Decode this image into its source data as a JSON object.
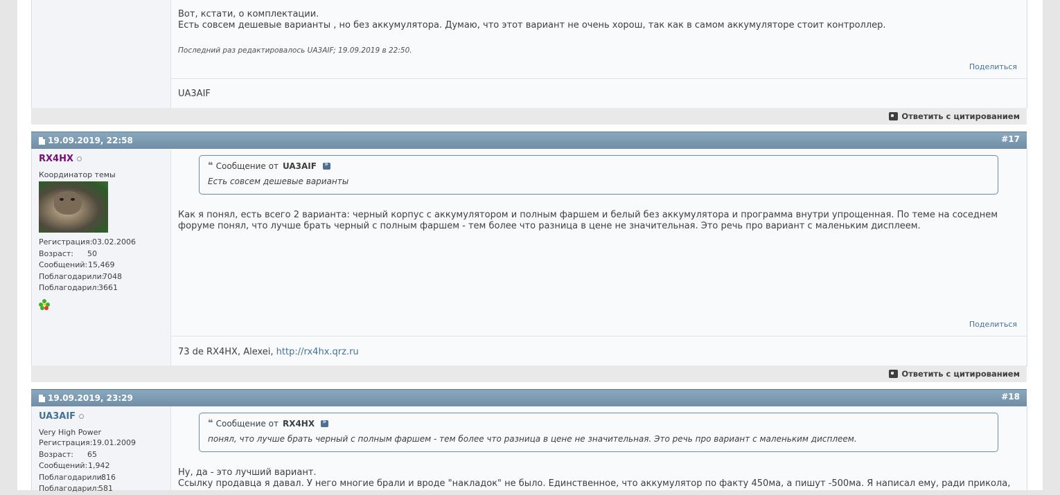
{
  "post16": {
    "body_lines": [
      "Вот, кстати, о комплектации.",
      "Есть совсем дешевые варианты , но без аккумулятора. Думаю, что этот вариант не очень хорош, так как в самом аккумуляторе стоит контроллер."
    ],
    "edited": "Последний раз редактировалось UA3AIF; 19.09.2019 в 22:50.",
    "share": "Поделиться",
    "signature": "UA3AIF",
    "reply_quote": "Ответить с цитированием"
  },
  "post17": {
    "date": "19.09.2019, 22:58",
    "number": "#17",
    "username": "RX4HX",
    "user_title": "Координатор темы",
    "stats": [
      {
        "label": "Регистрация:",
        "value": "03.02.2006"
      },
      {
        "label": "Возраст:",
        "value": "50"
      },
      {
        "label": "Сообщений:",
        "value": "15,469"
      },
      {
        "label": "Поблагодарили:",
        "value": "7048"
      },
      {
        "label": "Поблагодарил:",
        "value": "3661"
      }
    ],
    "quote_prefix": "Сообщение от",
    "quote_author": "UA3AIF",
    "quote_text": "Есть совсем дешевые варианты",
    "body": "Как я понял, есть всего 2 варианта: черный корпус с аккумулятором и полным фаршем и белый без аккумулятора и программа внутри упрощенная. По теме на соседнем форуме понял, что лучше брать черный с полным фаршем - тем более что разница в цене не значительная. Это речь про вариант с маленьким дисплеем.",
    "share": "Поделиться",
    "signature_text": "73 de RX4HX, Alexei,",
    "signature_link": "http://rx4hx.qrz.ru",
    "reply_quote": "Ответить с цитированием"
  },
  "post18": {
    "date": "19.09.2019, 23:29",
    "number": "#18",
    "username": "UA3AIF",
    "user_title": "Very High Power",
    "stats": [
      {
        "label": "Регистрация:",
        "value": "19.01.2009"
      },
      {
        "label": "Возраст:",
        "value": "65"
      },
      {
        "label": "Сообщений:",
        "value": "1,942"
      },
      {
        "label": "Поблагодарили:",
        "value": "816"
      },
      {
        "label": "Поблагодарил:",
        "value": "581"
      }
    ],
    "quote_prefix": "Сообщение от",
    "quote_author": "RX4HX",
    "quote_text": "понял, что лучше брать черный с полным фаршем - тем более что разница в цене не значительная. Это речь про вариант с маленьким дисплеем.",
    "body_lines": [
      "Ну, да - это лучший вариант.",
      "Ссылку продавца я давал. У него многие брали и вроде \"накладок\" не было. Единственное, что аккумулятор по факту 450ма, а пишут -500ма. Я написал ему, ради прикола,"
    ]
  },
  "colors": {
    "header": "#7896ad",
    "link": "#42729b",
    "username_rx4hx": "#7a0a7a",
    "username_ua3aif": "#42729b"
  }
}
